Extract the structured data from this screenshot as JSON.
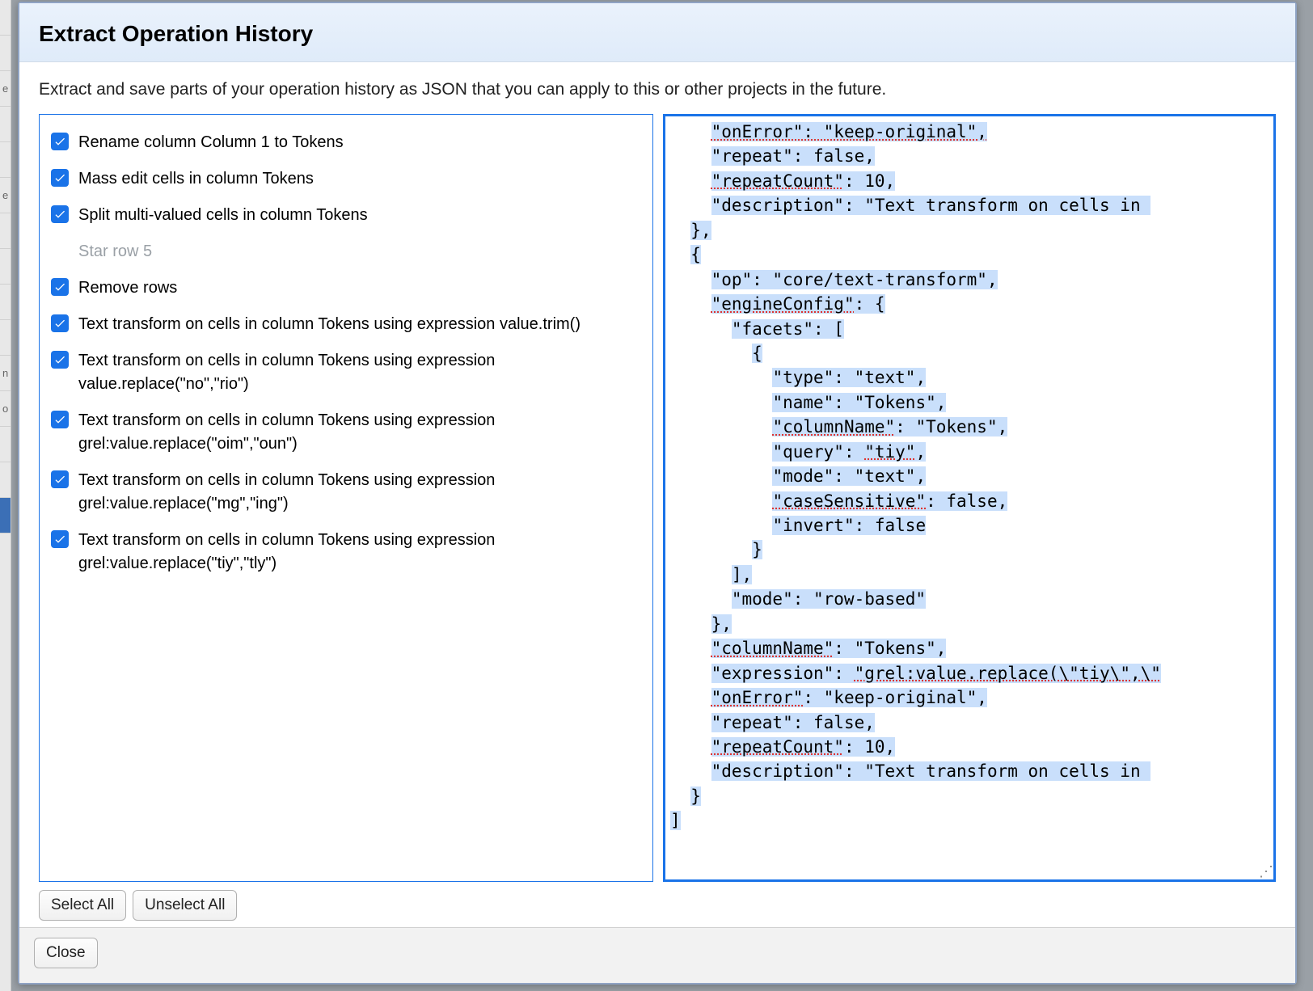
{
  "dialog": {
    "title": "Extract Operation History",
    "intro": "Extract and save parts of your operation history as JSON that you can apply to this or other projects in the future."
  },
  "operations": [
    {
      "checked": true,
      "label": "Rename column Column 1 to Tokens"
    },
    {
      "checked": true,
      "label": "Mass edit cells in column Tokens"
    },
    {
      "checked": true,
      "label": "Split multi-valued cells in column Tokens"
    },
    {
      "checked": false,
      "label": "Star row 5",
      "disabled": true
    },
    {
      "checked": true,
      "label": "Remove rows"
    },
    {
      "checked": true,
      "label": "Text transform on cells in column Tokens using expression value.trim()"
    },
    {
      "checked": true,
      "label": "Text transform on cells in column Tokens using expression value.replace(\"no\",\"rio\")"
    },
    {
      "checked": true,
      "label": "Text transform on cells in column Tokens using expression grel:value.replace(\"oim\",\"oun\")"
    },
    {
      "checked": true,
      "label": "Text transform on cells in column Tokens using expression grel:value.replace(\"mg\",\"ing\")"
    },
    {
      "checked": true,
      "label": "Text transform on cells in column Tokens using expression grel:value.replace(\"tiy\",\"tly\")"
    }
  ],
  "code_lines": [
    [
      {
        "t": "    "
      },
      {
        "t": "\"onError\": \"keep-original\",",
        "c": "hlw"
      }
    ],
    [
      {
        "t": "    "
      },
      {
        "t": "\"repeat\": false,",
        "c": "hl"
      }
    ],
    [
      {
        "t": "    "
      },
      {
        "t": "\"repeatCount\"",
        "c": "hlw"
      },
      {
        "t": ": 10,",
        "c": "hl"
      }
    ],
    [
      {
        "t": "    "
      },
      {
        "t": "\"description\": \"Text transform on cells in ",
        "c": "hl"
      }
    ],
    [
      {
        "t": "  "
      },
      {
        "t": "},",
        "c": "hl"
      }
    ],
    [
      {
        "t": "  "
      },
      {
        "t": "{",
        "c": "hl"
      }
    ],
    [
      {
        "t": "    "
      },
      {
        "t": "\"op\": \"core/text-transform\",",
        "c": "hl"
      }
    ],
    [
      {
        "t": "    "
      },
      {
        "t": "\"engineConfig\"",
        "c": "hlw"
      },
      {
        "t": ": {",
        "c": "hl"
      }
    ],
    [
      {
        "t": "      "
      },
      {
        "t": "\"facets\": [",
        "c": "hl"
      }
    ],
    [
      {
        "t": "        "
      },
      {
        "t": "{",
        "c": "hl"
      }
    ],
    [
      {
        "t": "          "
      },
      {
        "t": "\"type\": \"text\",",
        "c": "hl"
      }
    ],
    [
      {
        "t": "          "
      },
      {
        "t": "\"name\": \"Tokens\",",
        "c": "hl"
      }
    ],
    [
      {
        "t": "          "
      },
      {
        "t": "\"columnName\"",
        "c": "hlw"
      },
      {
        "t": ": \"Tokens\",",
        "c": "hl"
      }
    ],
    [
      {
        "t": "          "
      },
      {
        "t": "\"query\": ",
        "c": "hl"
      },
      {
        "t": "\"tiy\"",
        "c": "hlw"
      },
      {
        "t": ",",
        "c": "hl"
      }
    ],
    [
      {
        "t": "          "
      },
      {
        "t": "\"mode\": \"text\",",
        "c": "hl"
      }
    ],
    [
      {
        "t": "          "
      },
      {
        "t": "\"caseSensitive\"",
        "c": "hlw"
      },
      {
        "t": ": false,",
        "c": "hl"
      }
    ],
    [
      {
        "t": "          "
      },
      {
        "t": "\"invert\": false",
        "c": "hl"
      }
    ],
    [
      {
        "t": "        "
      },
      {
        "t": "}",
        "c": "hl"
      }
    ],
    [
      {
        "t": "      "
      },
      {
        "t": "],",
        "c": "hl"
      }
    ],
    [
      {
        "t": "      "
      },
      {
        "t": "\"mode\": \"row-based\"",
        "c": "hl"
      }
    ],
    [
      {
        "t": "    "
      },
      {
        "t": "},",
        "c": "hl"
      }
    ],
    [
      {
        "t": "    "
      },
      {
        "t": "\"columnName\"",
        "c": "hlw"
      },
      {
        "t": ": \"Tokens\",",
        "c": "hl"
      }
    ],
    [
      {
        "t": "    "
      },
      {
        "t": "\"expression\": ",
        "c": "hl"
      },
      {
        "t": "\"grel:value.replace(\\\"tiy\\\",\\\"",
        "c": "hlw"
      }
    ],
    [
      {
        "t": "    "
      },
      {
        "t": "\"onError\"",
        "c": "hlw"
      },
      {
        "t": ": \"keep-original\",",
        "c": "hl"
      }
    ],
    [
      {
        "t": "    "
      },
      {
        "t": "\"repeat\": false,",
        "c": "hl"
      }
    ],
    [
      {
        "t": "    "
      },
      {
        "t": "\"repeatCount\"",
        "c": "hlw"
      },
      {
        "t": ": 10,",
        "c": "hl"
      }
    ],
    [
      {
        "t": "    "
      },
      {
        "t": "\"description\": \"Text transform on cells in ",
        "c": "hl"
      }
    ],
    [
      {
        "t": "  "
      },
      {
        "t": "}",
        "c": "hl"
      }
    ],
    [
      {
        "t": "]",
        "c": "hl"
      }
    ]
  ],
  "buttons": {
    "select_all": "Select All",
    "unselect_all": "Unselect All",
    "close": "Close"
  }
}
